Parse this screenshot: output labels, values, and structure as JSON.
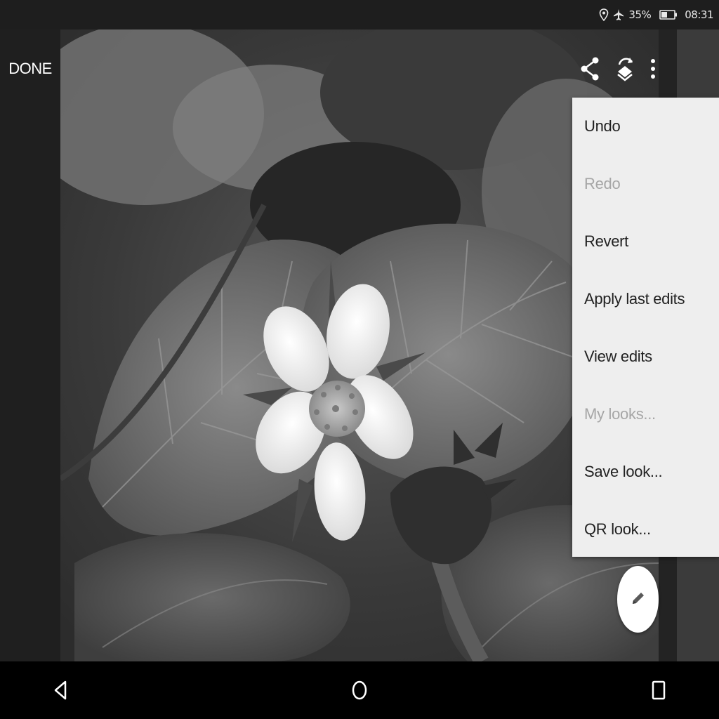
{
  "status_bar": {
    "battery_percent": "35%",
    "time": "08:31",
    "icons": [
      "location-icon",
      "airplane-mode-icon",
      "battery-icon"
    ]
  },
  "left_panel": {
    "done_label": "DONE"
  },
  "toolbar": {
    "icons": [
      "share-icon",
      "compare-icon",
      "more-options-icon"
    ]
  },
  "menu": {
    "items": [
      {
        "label": "Undo",
        "enabled": true
      },
      {
        "label": "Redo",
        "enabled": false
      },
      {
        "label": "Revert",
        "enabled": true
      },
      {
        "label": "Apply last edits",
        "enabled": true
      },
      {
        "label": "View edits",
        "enabled": true
      },
      {
        "label": "My looks...",
        "enabled": false
      },
      {
        "label": "Save look...",
        "enabled": true
      },
      {
        "label": "QR look...",
        "enabled": true
      }
    ]
  },
  "fab": {
    "icon": "edit-pencil-icon"
  },
  "nav_bar": {
    "icons": [
      "back-icon",
      "home-icon",
      "recents-icon"
    ]
  },
  "colors": {
    "menu_background": "#eeeeee",
    "menu_text": "#212121",
    "menu_text_disabled": "#a6a6a6",
    "chrome_dark": "#1e1e1e"
  }
}
